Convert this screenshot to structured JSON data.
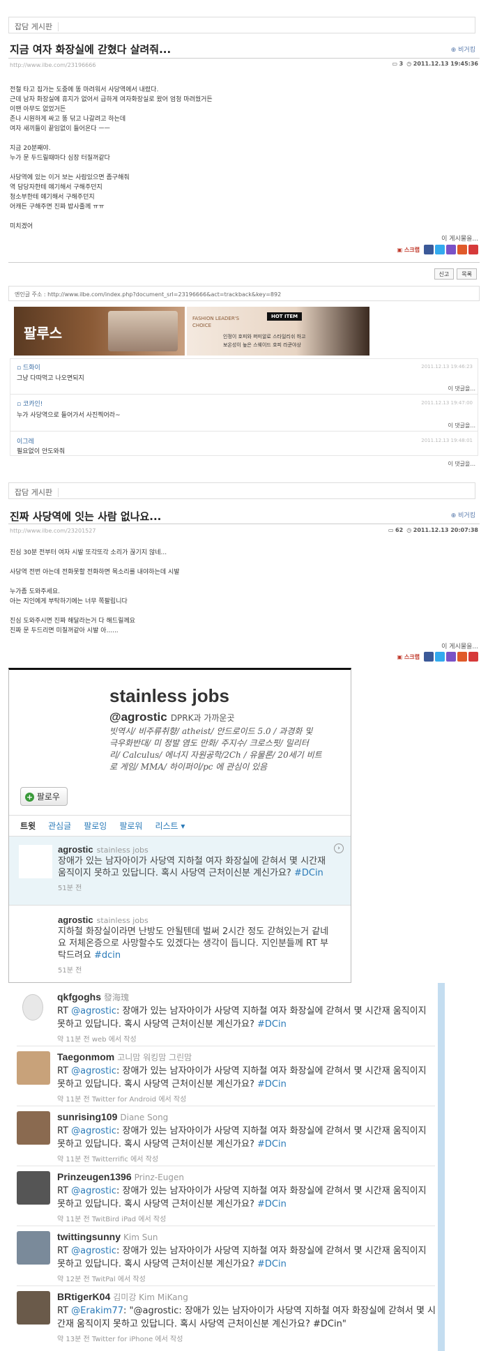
{
  "post1": {
    "board": "잡담 게시판",
    "title": "지금 여자 화장실에 갇혔다 살려줘...",
    "beg": "비거킹",
    "url": "http://www.ilbe.com/23196666",
    "comments_count": "3",
    "date": "2011.12.13 19:45:36",
    "body": [
      "전철 타고 집가는 도중에 똥 마려워서 사당역에서 내렸다.",
      "근데 남자 화장실에 휴지가 없어서 급하게 여자화장실로 왔어 엄청 마려웠거든",
      "이땐 아무도 없었거든",
      "존나 시원하게 싸고 똥 닦고 나갈려고 하는데",
      "여자 새끼들이 끝임없이 들어온다 ㅡㅡ",
      "",
      "지금 20분째야.",
      "누가 문 두드릴때마다 심장 터질꺼같다",
      "",
      "사당역에 있는 이거 보는 사람있으면 좀구해줘",
      "역 담당자한테 얘기해서 구해주던지",
      "청소부한테 얘기해서 구해주던지",
      "어캐든 구해주면 진짜 밥사줄께 ㅠㅠ",
      "",
      "미치겠어"
    ],
    "share_label": "이 게시물을...",
    "scrap": "스크랩",
    "report": "신고",
    "list": "목록",
    "trackback": "엔인글 주소 : http://www.ilbe.com/index.php?document_srl=23196666&act=trackback&key=892",
    "ad": {
      "brand": "팔루스",
      "headline": "FASHION LEADER'S CHOICE",
      "badge": "HOT ITEM",
      "line1": "인정이 호피와 퍼미알로 스타일리쉬 하고",
      "line2": "보온성이 높은 스웨이드 호피 라쿤야상"
    },
    "comments": [
      {
        "user": "드화이",
        "date": "2011.12.13 19:46:23",
        "text": "그냥 다따먹고 나오면되지",
        "reply": "이 댓글을..."
      },
      {
        "user": "코카인!",
        "date": "2011.12.13 19:47:00",
        "text": "누가 사당역으로 들어가서 사진찍어라~",
        "reply": "이 댓글을..."
      },
      {
        "user": "이그레",
        "date": "2011.12.13 19:48:01",
        "text": "필요없이 안도와줘",
        "reply": "이 댓글을..."
      }
    ]
  },
  "post2": {
    "board": "잡담 게시판",
    "title": "진짜 사당역에 잇는 사람 없나요...",
    "beg": "비거킹",
    "url": "http://www.ilbe.com/23201527",
    "comments_count": "62",
    "date": "2011.12.13 20:07:38",
    "body": [
      "진심 30분 전부터 여자 시발 또각또각 소리가 끊기지 않네...",
      "",
      "사당역 전번 아는데 전화못할 전화하면 목소리를 내야하는데 시발",
      "",
      "누가좀 도와주세요.",
      "아는 지인에게 부탁하기에는 너무 쪽팔립니다",
      "",
      "진심 도와주시면 진짜 해달라는거 다 해드릴께요",
      "진짜 문 두드리면 미칠꺼같아 시발 아......"
    ],
    "share_label": "이 게시물을...",
    "scrap": "스크랩"
  },
  "twitter_profile": {
    "name": "stainless jobs",
    "handle": "@agrostic",
    "location": "DPRK과 가까운곳",
    "bio": [
      "빗역시/ 비주류취향/ atheist/ 안드로이드 5.0 / 과경화 및",
      "극우화반대/ 미 정발 염도 만화/ 주지수/ 크로스핏/ 밀리터",
      "리/ Calculus/ 에너지 자원공학/2Ch / 유물론/ 20세기 비트",
      "로 게임/ MMA/ 하이퍼이/pc 에 관심이 있음"
    ],
    "follow": "팔로우",
    "tabs": [
      "트윗",
      "관심글",
      "팔로잉",
      "팔로워",
      "리스트 ▾"
    ],
    "tweets": [
      {
        "user": "agrostic",
        "realname": "stainless jobs",
        "text": "장애가 있는 남자아이가 사당역 지하철 여자 화장실에 갇혀서 몇 시간재 움직이지 못하고 있답니다. 혹시 사당역 근처이신분 계신가요? ",
        "hashtag": "#DCin",
        "time": "51분 전"
      },
      {
        "user": "agrostic",
        "realname": "stainless jobs",
        "text": "지하철 화장실이라면 난방도 안될텐데 벌써 2시간 정도 갇혀있는거 같네요 저체온증으로 사망할수도 있겠다는 생각이 듭니다. 지인분들께 RT 부탁드려요 ",
        "hashtag": "#dcin",
        "time": "51분 전"
      }
    ]
  },
  "retweets": [
    {
      "user": "qkfgoghs",
      "real": "發海瑰",
      "prefix": "RT ",
      "mention": "@agrostic",
      "text": ": 장애가 있는 남자아이가 사당역 지하철 여자 화장실에 갇혀서 몇 시간재 움직이지 못하고 있답니다. 혹시 사당역 근처이신분 계신가요? ",
      "hashtag": "#DCin",
      "meta": "약 11분 전 web 에서 작성",
      "avatar_color": "#e8e8e8"
    },
    {
      "user": "Taegonmom",
      "real": "고니맘 워킹맘 그린맘",
      "prefix": "RT ",
      "mention": "@agrostic",
      "text": ": 장애가 있는 남자아이가 사당역 지하철 여자 화장실에 갇혀서 몇 시간재 움직이지 못하고 있답니다. 혹시 사당역 근처이신분 계신가요? ",
      "hashtag": "#DCin",
      "meta": "약 11분 전 Twitter for Android 에서 작성",
      "avatar_color": "#c8a27a"
    },
    {
      "user": "sunrising109",
      "real": "Diane Song",
      "prefix": "RT ",
      "mention": "@agrostic",
      "text": ": 장애가 있는 남자아이가 사당역 지하철 여자 화장실에 갇혀서 몇 시간재 움직이지 못하고 있답니다. 혹시 사당역 근처이신분 계신가요? ",
      "hashtag": "#DCin",
      "meta": "약 11분 전 Twitterrific 에서 작성",
      "avatar_color": "#8a6a50"
    },
    {
      "user": "Prinzeugen1396",
      "real": "Prinz-Eugen",
      "prefix": "RT ",
      "mention": "@agrostic",
      "text": ": 장애가 있는 남자아이가 사당역 지하철 여자 화장실에 갇혀서 몇 시간재 움직이지 못하고 있답니다. 혹시 사당역 근처이신분 계신가요? ",
      "hashtag": "#DCin",
      "meta": "약 11분 전 TwitBird iPad 에서 작성",
      "avatar_color": "#555555"
    },
    {
      "user": "twittingsunny",
      "real": "Kim Sun",
      "prefix": "RT ",
      "mention": "@agrostic",
      "text": ": 장애가 있는 남자아이가 사당역 지하철 여자 화장실에 갇혀서 몇 시간재 움직이지 못하고 있답니다. 혹시 사당역 근처이신분 계신가요? ",
      "hashtag": "#DCin",
      "meta": "약 12분 전 TwitPal 에서 작성",
      "avatar_color": "#7a8a9a"
    },
    {
      "user": "BRtigerK04",
      "real": "김미강 Kim MiKang",
      "prefix": "RT ",
      "mention": "@Erakim77",
      "text": ": \"@agrostic: 장애가 있는 남자아이가 사당역 지하철 여자 화장실에 갇혀서 몇 시간재 움직이지 못하고 있답니다. 혹시 사당역 근처이신분 계신가요? #DCin\"",
      "hashtag": "",
      "meta": "약 13분 전 Twitter for iPhone 에서 작성",
      "avatar_color": "#6a5a4a"
    }
  ],
  "colors": {
    "link": "#2a7ab8",
    "tweet_highlight": "#eaf4f8",
    "panel_border": "#c4ddf0"
  }
}
